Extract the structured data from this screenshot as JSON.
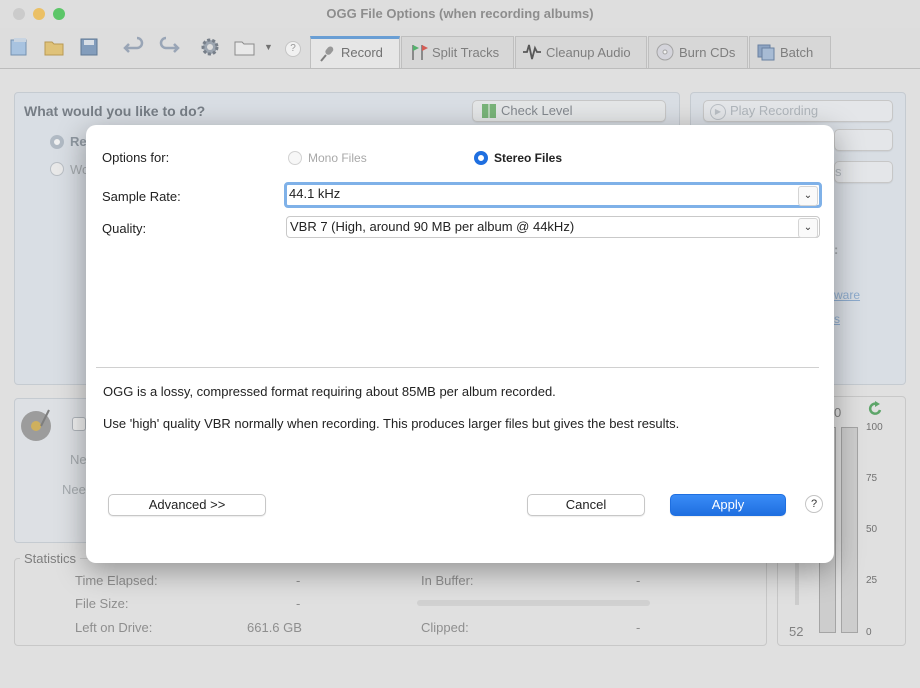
{
  "window": {
    "title": "OGG File Options (when recording albums)"
  },
  "tabs": [
    {
      "label": "Record",
      "icon": "microphone-icon",
      "active": true
    },
    {
      "label": "Split Tracks",
      "icon": "flags-icon"
    },
    {
      "label": "Cleanup Audio",
      "icon": "waveform-icon"
    },
    {
      "label": "Burn CDs",
      "icon": "cd-icon"
    },
    {
      "label": "Batch",
      "icon": "batch-icon"
    }
  ],
  "background": {
    "prompt": "What would you like to do?",
    "radio_1": "Re",
    "radio_2": "Wo",
    "check_level": "Check Level",
    "play_recording": "Play Recording",
    "side_s": "s",
    "side_colon": ":",
    "side_ware": "ware",
    "side_s2": "s",
    "need_1": "Ne",
    "need_2": "Nee",
    "meter_left_value": "0",
    "meter_value": "52",
    "meter_ticks": [
      "100",
      "75",
      "50",
      "25",
      "0"
    ],
    "stats": {
      "title": "Statistics",
      "time_elapsed_label": "Time Elapsed:",
      "time_elapsed_value": "-",
      "file_size_label": "File Size:",
      "file_size_value": "-",
      "left_on_drive_label": "Left on Drive:",
      "left_on_drive_value": "661.6 GB",
      "in_buffer_label": "In Buffer:",
      "in_buffer_value": "-",
      "clipped_label": "Clipped:",
      "clipped_value": "-"
    }
  },
  "dialog": {
    "options_for_label": "Options for:",
    "mono_label": "Mono Files",
    "stereo_label": "Stereo Files",
    "selected_option": "Stereo Files",
    "sample_rate_label": "Sample Rate:",
    "sample_rate_value": "44.1 kHz",
    "quality_label": "Quality:",
    "quality_value": "VBR 7 (High, around 90 MB per album @ 44kHz)",
    "info_line_1": "OGG is a lossy, compressed format requiring about 85MB per album recorded.",
    "info_line_2": "Use 'high' quality VBR normally when recording.  This produces larger files but gives the best results.",
    "advanced_label": "Advanced >>",
    "cancel_label": "Cancel",
    "apply_label": "Apply",
    "help_label": "?"
  },
  "colors": {
    "accent": "#1f6fe0",
    "tab_highlight": "#4a90d9"
  }
}
